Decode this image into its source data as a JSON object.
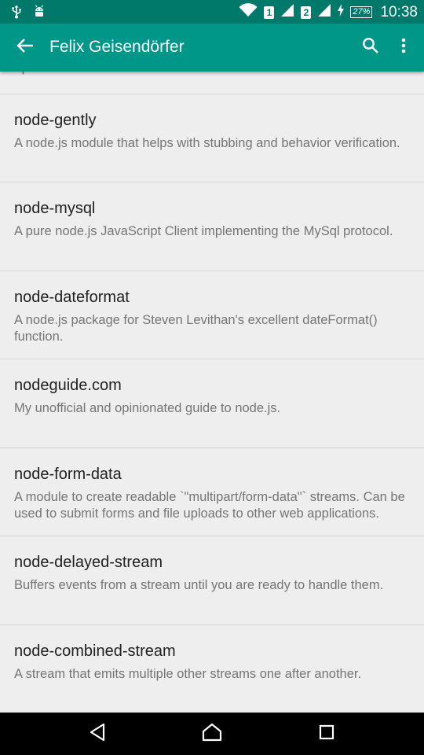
{
  "status_bar": {
    "sim1": "1",
    "sim2": "2",
    "battery": "27%",
    "time": "10:38"
  },
  "app_bar": {
    "title": "Felix Geisendörfer",
    "icons": [
      "back-arrow-icon",
      "search-icon",
      "more-vert-icon"
    ]
  },
  "list": {
    "partial_text": "uploads.",
    "items": [
      {
        "title": "node-gently",
        "description": "A node.js module that helps with stubbing and behavior verification."
      },
      {
        "title": "node-mysql",
        "description": "A pure node.js JavaScript Client implementing the MySql protocol."
      },
      {
        "title": "node-dateformat",
        "description": "A node.js package for Steven Levithan's excellent dateFormat() function."
      },
      {
        "title": "nodeguide.com",
        "description": "My unofficial and opinionated guide to node.js."
      },
      {
        "title": "node-form-data",
        "description": "A module to create readable `\"multipart/form-data\"` streams. Can be used to submit forms and file uploads to other web applications."
      },
      {
        "title": "node-delayed-stream",
        "description": "Buffers events from a stream until you are ready to handle them."
      },
      {
        "title": "node-combined-stream",
        "description": "A stream that emits multiple other streams one after another."
      }
    ]
  },
  "nav_bar": {
    "icons": [
      "back-triangle-icon",
      "home-icon",
      "recents-icon"
    ]
  },
  "colors": {
    "status_bar": "#00796b",
    "app_bar": "#009688",
    "background": "#eeeeee",
    "title_text": "#212121",
    "secondary_text": "#757575"
  }
}
